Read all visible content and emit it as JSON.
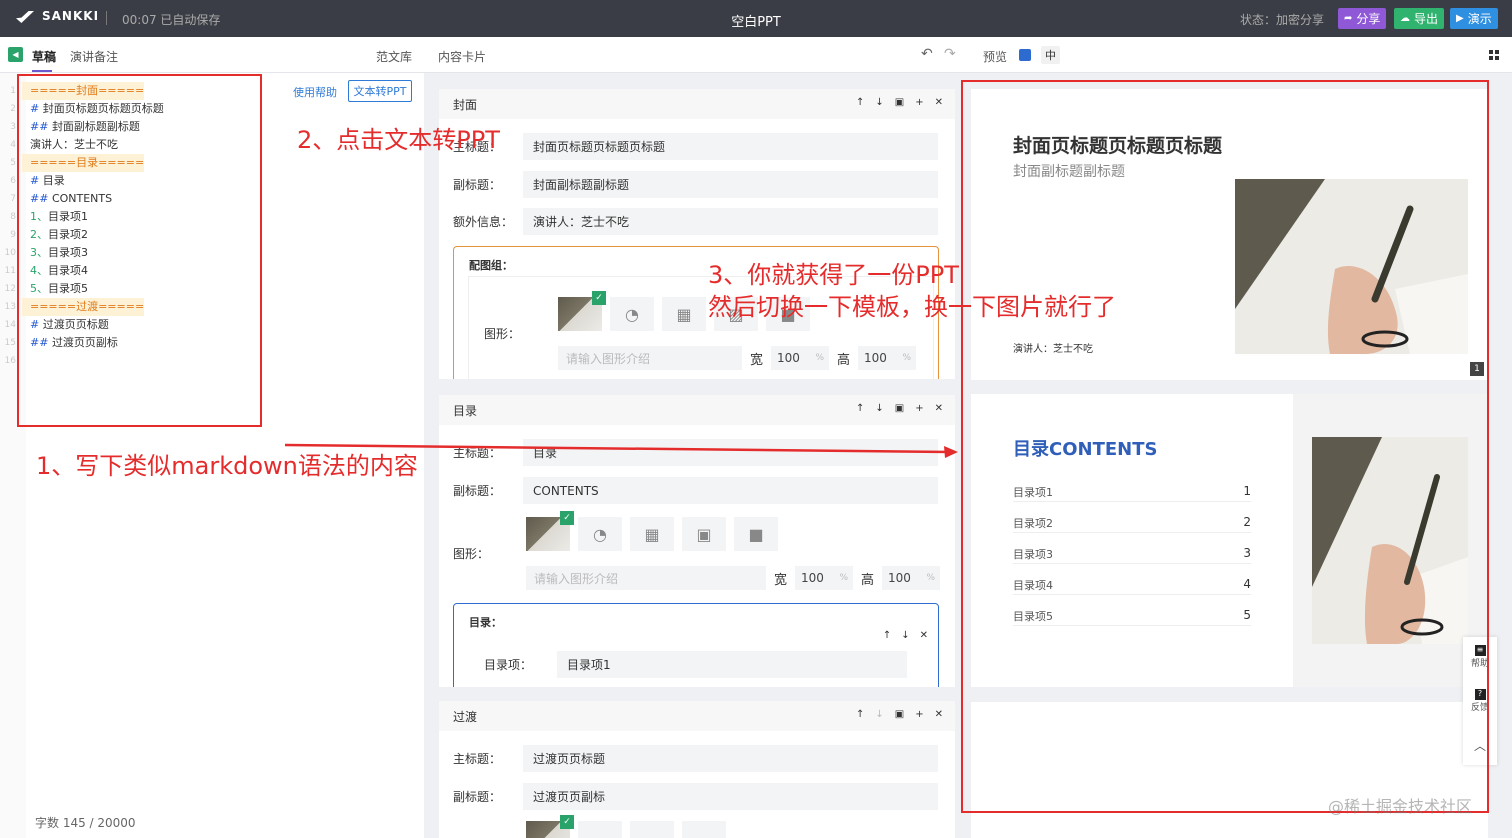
{
  "topbar": {
    "logo": "SANKKI",
    "autosave": "00:07 已自动保存",
    "title": "空白PPT",
    "status": "状态：加密分享",
    "share": "分享",
    "export": "导出",
    "present": "演示"
  },
  "toolbar": {
    "tab_draft": "草稿",
    "tab_notes": "演讲备注",
    "template_lib": "范文库",
    "content_card": "内容卡片",
    "undo_icon": "undo-icon",
    "redo_icon": "redo-icon",
    "preview": "预览",
    "lang": "中",
    "accent_color": "#2d6bd1"
  },
  "editor": {
    "help": "使用帮助",
    "convert_button": "文本转PPT",
    "lines": [
      {
        "n": "1",
        "text": "=====封面====="
      },
      {
        "n": "2",
        "text": "# 封面页标题页标题页标题"
      },
      {
        "n": "3",
        "text": "## 封面副标题副标题"
      },
      {
        "n": "4",
        "text": "演讲人：芝士不吃"
      },
      {
        "n": "5",
        "text": "=====目录====="
      },
      {
        "n": "6",
        "text": "# 目录"
      },
      {
        "n": "7",
        "text": "## CONTENTS"
      },
      {
        "n": "8",
        "text": "1、目录项1"
      },
      {
        "n": "9",
        "text": "2、目录项2"
      },
      {
        "n": "10",
        "text": "3、目录项3"
      },
      {
        "n": "11",
        "text": "4、目录项4"
      },
      {
        "n": "12",
        "text": "5、目录项5"
      },
      {
        "n": "13",
        "text": "=====过渡====="
      },
      {
        "n": "14",
        "text": "# 过渡页页标题"
      },
      {
        "n": "15",
        "text": "## 过渡页页副标"
      },
      {
        "n": "16",
        "text": ""
      }
    ],
    "wordcount": "字数  145 / 20000"
  },
  "cards": {
    "cover": {
      "title": "封面",
      "main_label": "主标题：",
      "main_value": "封面页标题页标题页标题",
      "sub_label": "副标题：",
      "sub_value": "封面副标题副标题",
      "extra_label": "额外信息：",
      "extra_value": "演讲人：芝士不吃",
      "group_title": "配图组：",
      "shape_label": "图形：",
      "shape_placeholder": "请输入图形介绍",
      "width_label": "宽",
      "width_value": "100",
      "height_label": "高",
      "height_value": "100",
      "pct": "%"
    },
    "toc": {
      "title": "目录",
      "main_label": "主标题：",
      "main_value": "目录",
      "sub_label": "副标题：",
      "sub_value": "CONTENTS",
      "shape_label": "图形：",
      "shape_placeholder": "请输入图形介绍",
      "width_label": "宽",
      "width_value": "100",
      "height_label": "高",
      "height_value": "100",
      "pct": "%",
      "group_title": "目录：",
      "item_label": "目录项：",
      "item_value": "目录项1"
    },
    "transition": {
      "title": "过渡",
      "main_label": "主标题：",
      "main_value": "过渡页页标题",
      "sub_label": "副标题：",
      "sub_value": "过渡页页副标"
    }
  },
  "preview": {
    "slide1": {
      "title": "封面页标题页标题页标题",
      "subtitle": "封面副标题副标题",
      "speaker": "演讲人：芝士不吃",
      "page": "1"
    },
    "slide2": {
      "title_cn": "目录",
      "title_en": "CONTENTS",
      "items": [
        {
          "label": "目录项1",
          "idx": "1"
        },
        {
          "label": "目录项2",
          "idx": "2"
        },
        {
          "label": "目录项3",
          "idx": "3"
        },
        {
          "label": "目录项4",
          "idx": "4"
        },
        {
          "label": "目录项5",
          "idx": "5"
        }
      ]
    },
    "float_help": "帮助",
    "float_feedback": "反馈"
  },
  "annotations": {
    "step1": "1、写下类似markdown语法的内容",
    "step2": "2、点击文本转PPT",
    "step3_line1": "3、你就获得了一份PPT",
    "step3_line2": "然后切换一下模板，换一下图片就行了",
    "color": "#e52c2c"
  },
  "watermark": "@稀土掘金技术社区"
}
